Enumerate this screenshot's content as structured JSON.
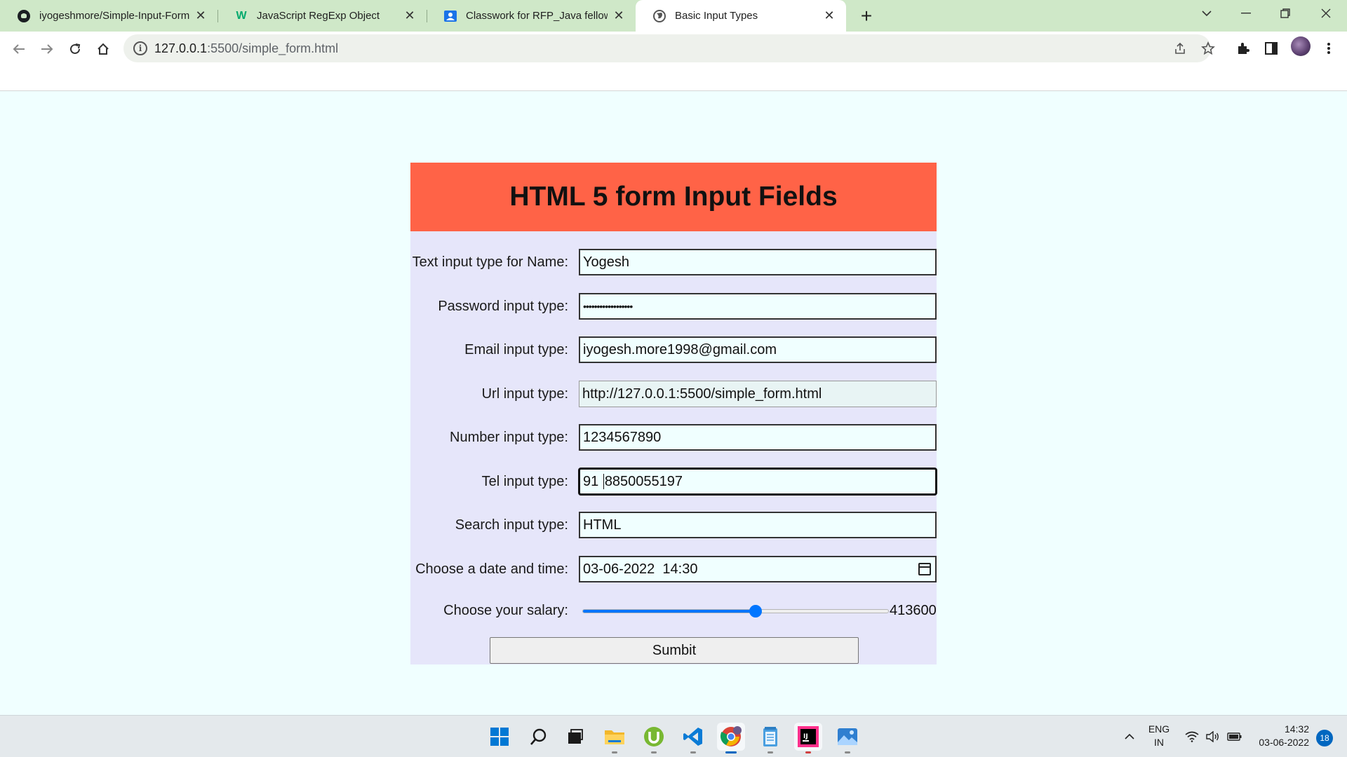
{
  "browser": {
    "tabs": [
      {
        "title": "iyogeshmore/Simple-Input-Form",
        "icon": "github-icon",
        "active": false
      },
      {
        "title": "JavaScript RegExp Object",
        "icon": "w3schools-icon",
        "active": false
      },
      {
        "title": "Classwork for RFP_Java fellowship",
        "icon": "classroom-icon",
        "active": false
      },
      {
        "title": "Basic Input Types",
        "icon": "globe-icon",
        "active": true
      }
    ],
    "new_tab_symbol": "+",
    "url_host": "127.0.0.1",
    "url_path": ":5500/simple_form.html"
  },
  "form": {
    "heading": "HTML 5 form Input Fields",
    "fields": [
      {
        "label": "Text input type for Name:",
        "value": "Yogesh"
      },
      {
        "label": "Password input type:",
        "value": "••••••••••••••••••"
      },
      {
        "label": "Email input type:",
        "value": "iyogesh.more1998@gmail.com"
      },
      {
        "label": "Url input type:",
        "value": "http://127.0.0.1:5500/simple_form.html"
      },
      {
        "label": "Number input type:",
        "value": "1234567890"
      },
      {
        "label": "Tel input type:",
        "value_before_caret": "91 ",
        "value_after_caret": "8850055197"
      },
      {
        "label": "Search input type:",
        "value": "HTML"
      },
      {
        "label": "Choose a date and time:",
        "value": "03-06-2022  14:30"
      }
    ],
    "salary": {
      "label": "Choose your salary:",
      "value": "413600",
      "fraction": 0.565
    },
    "submit_label": "Sumbit"
  },
  "taskbar": {
    "lang_line1": "ENG",
    "lang_line2": "IN",
    "time": "14:32",
    "date": "03-06-2022",
    "notification_count": "18"
  },
  "colors": {
    "page_background": "#f0ffff",
    "form_background": "#e6e6fa",
    "header_background": "#ff6347",
    "slider_accent": "#0075ff",
    "tabstrip": "#cfe8c8"
  }
}
